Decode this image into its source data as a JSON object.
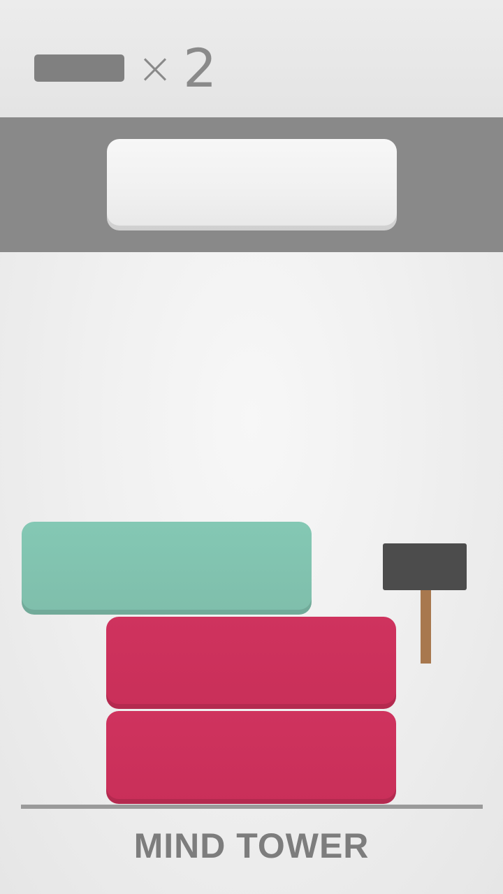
{
  "hud": {
    "block_icon": "block-icon",
    "times_symbol": "×",
    "count": "2"
  },
  "next_block": {
    "color": "#f2f2f2"
  },
  "tower": {
    "blocks": [
      {
        "color": "#82c3b0",
        "role": "teal-block"
      },
      {
        "color": "#cc315b",
        "role": "red-block"
      },
      {
        "color": "#cc315b",
        "role": "red-block"
      }
    ]
  },
  "tool": {
    "icon": "hammer-icon",
    "head_color": "#4c4c4c",
    "handle_color": "#a8784e"
  },
  "footer": {
    "title": "MIND TOWER"
  }
}
